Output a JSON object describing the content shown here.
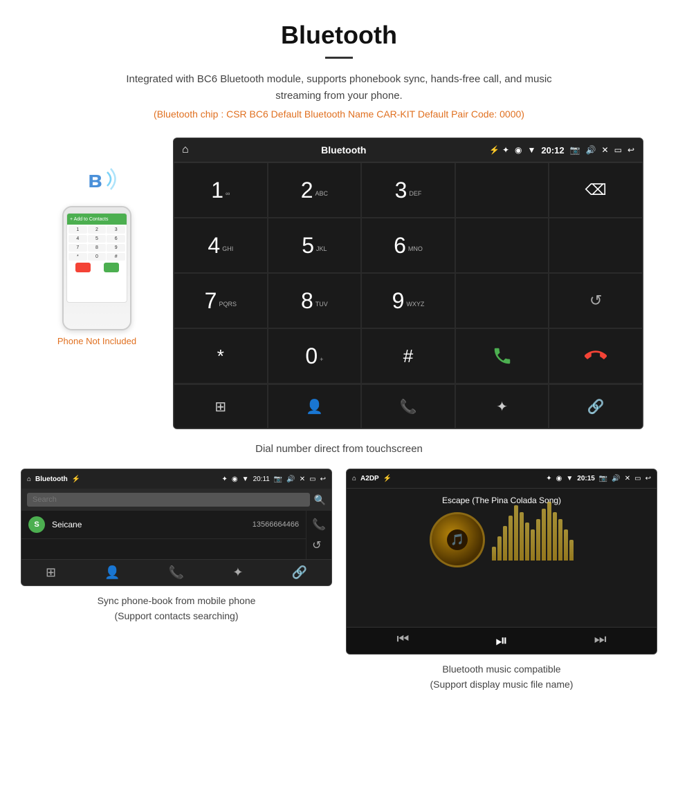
{
  "header": {
    "title": "Bluetooth",
    "description": "Integrated with BC6 Bluetooth module, supports phonebook sync, hands-free call, and music streaming from your phone.",
    "specs": "(Bluetooth chip : CSR BC6    Default Bluetooth Name CAR-KIT    Default Pair Code: 0000)"
  },
  "phone_label": "Phone Not Included",
  "car_unit": {
    "status_bar": {
      "home": "⌂",
      "title": "Bluetooth",
      "usb": "⚡",
      "time": "20:12",
      "icons": "✦ ◉ ▼ ◻ ◁ □ ↩"
    },
    "dialpad": [
      {
        "num": "1",
        "sub": "∞",
        "span": 1
      },
      {
        "num": "2",
        "sub": "ABC",
        "span": 1
      },
      {
        "num": "3",
        "sub": "DEF",
        "span": 1
      },
      {
        "num": "",
        "sub": "",
        "span": 1,
        "type": "empty"
      },
      {
        "num": "⌫",
        "sub": "",
        "span": 1,
        "type": "backspace"
      },
      {
        "num": "4",
        "sub": "GHI",
        "span": 1
      },
      {
        "num": "5",
        "sub": "JKL",
        "span": 1
      },
      {
        "num": "6",
        "sub": "MNO",
        "span": 1
      },
      {
        "num": "",
        "sub": "",
        "span": 1,
        "type": "empty"
      },
      {
        "num": "",
        "sub": "",
        "span": 1,
        "type": "empty"
      },
      {
        "num": "7",
        "sub": "PQRS",
        "span": 1
      },
      {
        "num": "8",
        "sub": "TUV",
        "span": 1
      },
      {
        "num": "9",
        "sub": "WXYZ",
        "span": 1
      },
      {
        "num": "",
        "sub": "",
        "span": 1,
        "type": "empty"
      },
      {
        "num": "↺",
        "sub": "",
        "span": 1,
        "type": "reload"
      },
      {
        "num": "*",
        "sub": "",
        "span": 1
      },
      {
        "num": "0",
        "sub": "+",
        "span": 1
      },
      {
        "num": "#",
        "sub": "",
        "span": 1
      },
      {
        "num": "📞",
        "sub": "",
        "span": 1,
        "type": "green-call"
      },
      {
        "num": "📵",
        "sub": "",
        "span": 1,
        "type": "red-call"
      }
    ],
    "bottom_bar": [
      "⊞",
      "👤",
      "📞",
      "✦",
      "🔗"
    ]
  },
  "dial_caption": "Dial number direct from touchscreen",
  "phonebook": {
    "status_title": "Bluetooth",
    "time": "20:11",
    "search_placeholder": "Search",
    "contact": {
      "initial": "S",
      "name": "Seicane",
      "number": "13566664466"
    },
    "bottom_icons": [
      "⊞",
      "👤",
      "📞",
      "✦",
      "🔗"
    ]
  },
  "phonebook_caption": "Sync phone-book from mobile phone\n(Support contacts searching)",
  "music": {
    "status_title": "A2DP",
    "time": "20:15",
    "song_title": "Escape (The Pina Colada Song)",
    "eq_bars": [
      20,
      35,
      50,
      65,
      80,
      70,
      55,
      45,
      60,
      75,
      85,
      70,
      60,
      45,
      30
    ]
  },
  "music_caption": "Bluetooth music compatible\n(Support display music file name)"
}
